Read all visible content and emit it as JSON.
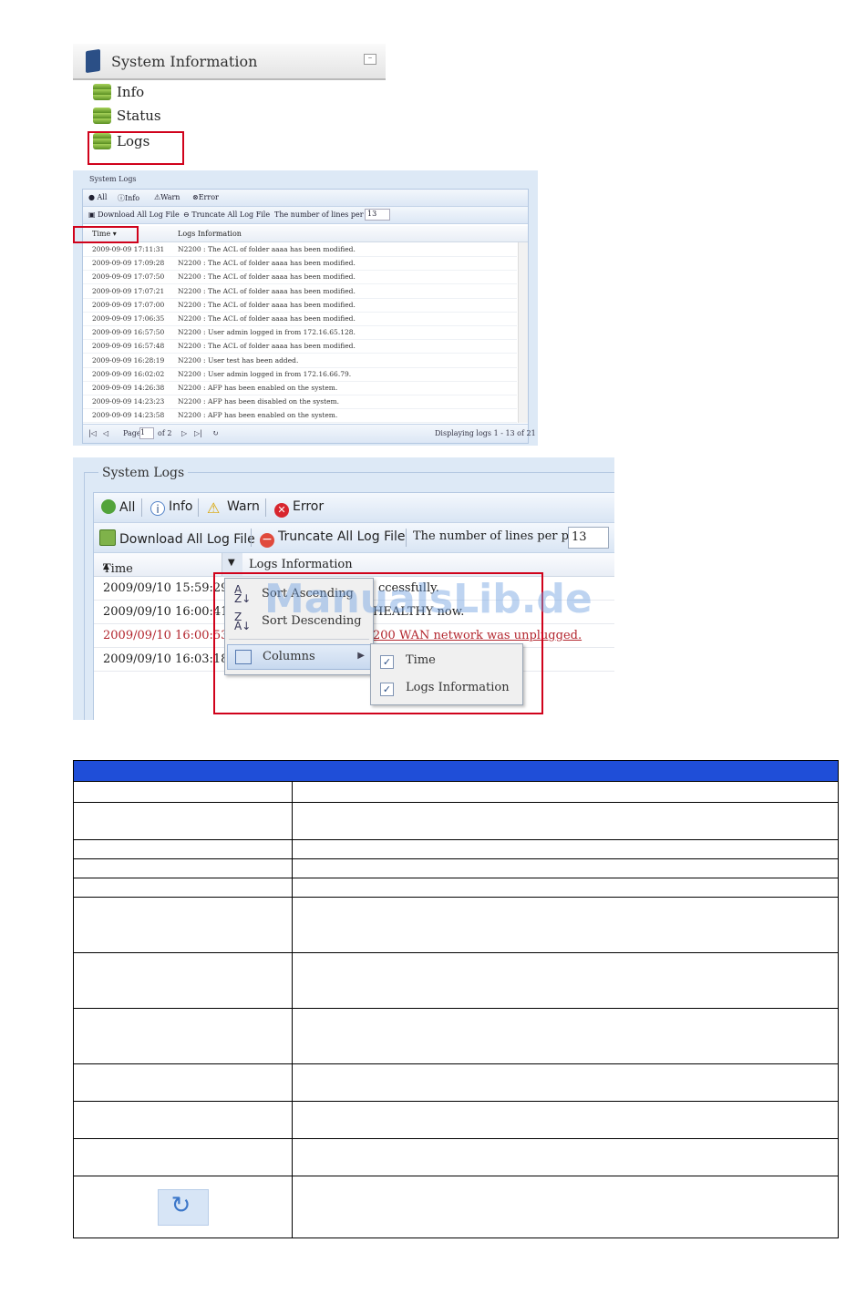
{
  "sysinfo": {
    "title": "System Information",
    "items": [
      {
        "label": "Info"
      },
      {
        "label": "Status"
      },
      {
        "label": "Logs"
      }
    ]
  },
  "logs_small": {
    "legend": "System Logs",
    "filters": [
      "All",
      "Info",
      "Warn",
      "Error"
    ],
    "download": "Download All Log File",
    "truncate": "Truncate All Log File",
    "lines_label": "The number of lines per page",
    "lines_value": "13",
    "col_time": "Time",
    "col_info": "Logs Information",
    "rows": [
      {
        "time": "2009-09-09 17:11:31",
        "msg": "N2200 : The ACL of folder aaaa has been modified."
      },
      {
        "time": "2009-09-09 17:09:28",
        "msg": "N2200 : The ACL of folder aaaa has been modified."
      },
      {
        "time": "2009-09-09 17:07:50",
        "msg": "N2200 : The ACL of folder aaaa has been modified."
      },
      {
        "time": "2009-09-09 17:07:21",
        "msg": "N2200 : The ACL of folder aaaa has been modified."
      },
      {
        "time": "2009-09-09 17:07:00",
        "msg": "N2200 : The ACL of folder aaaa has been modified."
      },
      {
        "time": "2009-09-09 17:06:35",
        "msg": "N2200 : The ACL of folder aaaa has been modified."
      },
      {
        "time": "2009-09-09 16:57:50",
        "msg": "N2200 : User admin logged in from 172.16.65.128."
      },
      {
        "time": "2009-09-09 16:57:48",
        "msg": "N2200 : The ACL of folder aaaa has been modified."
      },
      {
        "time": "2009-09-09 16:28:19",
        "msg": "N2200 : User test has been added."
      },
      {
        "time": "2009-09-09 16:02:02",
        "msg": "N2200 : User admin logged in from 172.16.66.79."
      },
      {
        "time": "2009-09-09 14:26:38",
        "msg": "N2200 : AFP has been enabled on the system."
      },
      {
        "time": "2009-09-09 14:23:23",
        "msg": "N2200 : AFP has been disabled on the system."
      },
      {
        "time": "2009-09-09 14:23:58",
        "msg": "N2200 : AFP has been enabled on the system."
      }
    ],
    "page_label": "Page",
    "page_value": "1",
    "page_of": "of 2",
    "displaying": "Displaying logs 1 - 13 of 21"
  },
  "logs_big": {
    "legend": "System Logs",
    "filters": [
      "All",
      "Info",
      "Warn",
      "Error"
    ],
    "download": "Download All Log File",
    "truncate": "Truncate All Log File",
    "lines_label": "The number of lines per page",
    "lines_value": "13",
    "col_time": "Time",
    "col_info": "Logs Information",
    "rows": [
      {
        "time": "2009/09/10 15:59:29",
        "msg": "ccessfully."
      },
      {
        "time": "2009/09/10 16:00:41",
        "msg": "HEALTHY now."
      },
      {
        "time": "2009/09/10 16:00:53",
        "msg": "200 WAN network was unplugged."
      },
      {
        "time": "2009/09/10 16:03:18",
        "msg": ""
      }
    ],
    "menu": {
      "sort_asc": "Sort Ascending",
      "sort_desc": "Sort Descending",
      "columns": "Columns",
      "sub": [
        "Time",
        "Logs Information"
      ]
    },
    "colors": {
      "error_text": "#b3262e"
    }
  },
  "watermark": "ManualsLib.de",
  "table": {
    "header_color": "#1f4ed8",
    "row_count": 12
  }
}
